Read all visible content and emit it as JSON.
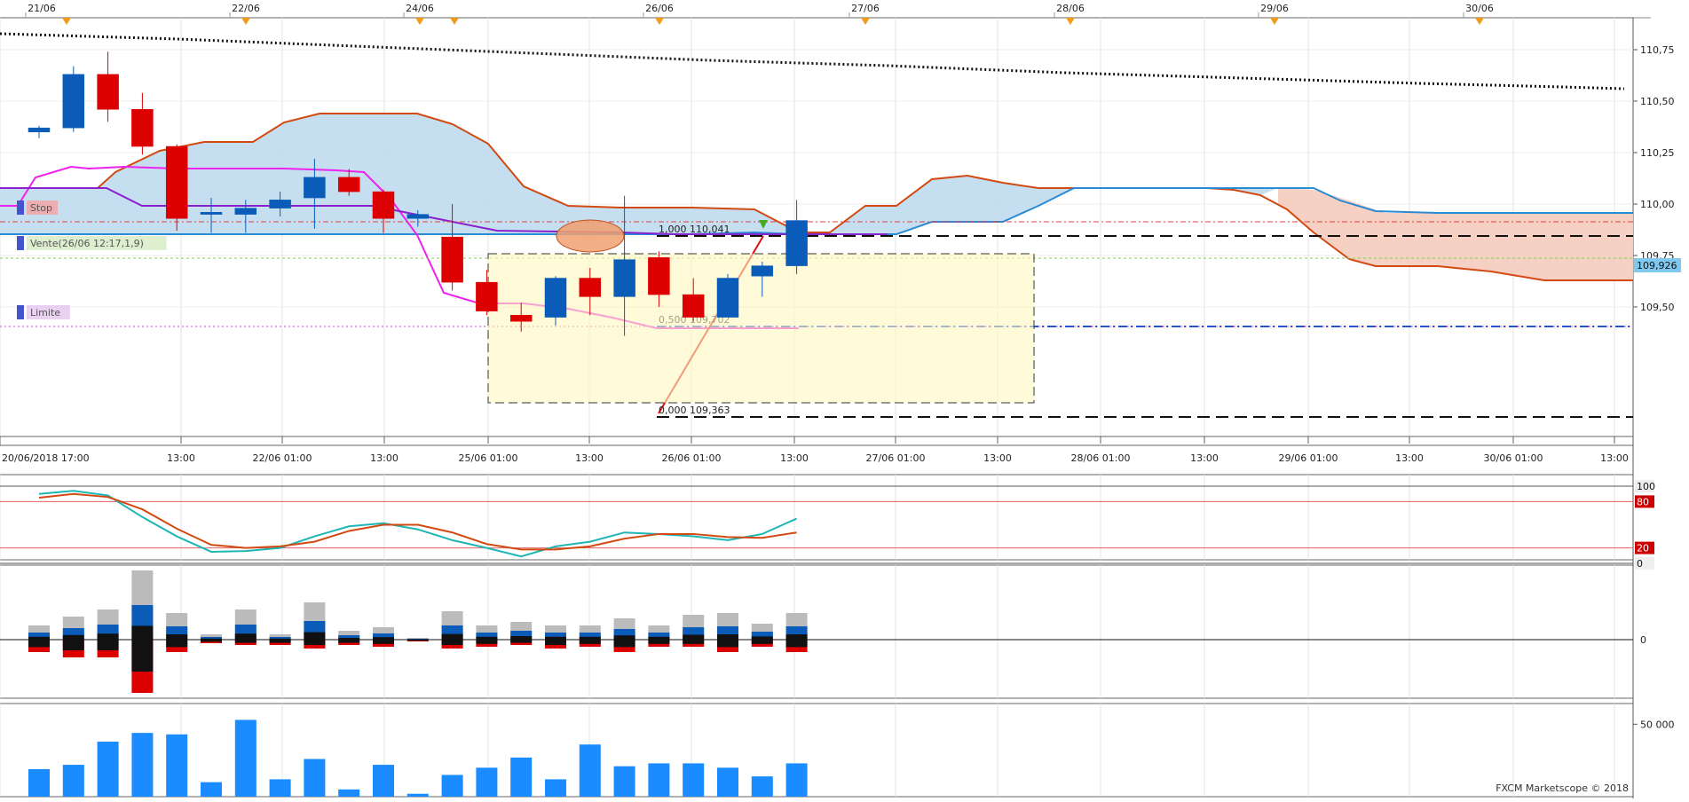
{
  "top_dates": [
    "21/06",
    "22/06",
    "24/06",
    "26/06",
    "27/06",
    "28/06",
    "29/06",
    "30/06"
  ],
  "time_labels": [
    "20/06/2018 17:00",
    "13:00",
    "22/06 01:00",
    "13:00",
    "25/06 01:00",
    "13:00",
    "26/06 01:00",
    "13:00",
    "27/06 01:00",
    "13:00",
    "28/06 01:00",
    "13:00",
    "29/06 01:00",
    "13:00",
    "30/06 01:00",
    "13:00"
  ],
  "price_labels": [
    "110,75",
    "110,50",
    "110,25",
    "110,00",
    "109,75",
    "109,50"
  ],
  "current_price": "109,926",
  "orders": {
    "stop": "Stop",
    "sell": "Vente(26/06 12:17,1,9)",
    "limit": "Limite"
  },
  "fib": {
    "top": "1,000 110,041",
    "mid": "0,500 109,702",
    "bottom": "0,000 109,363"
  },
  "stoch_labels": [
    "100",
    "80",
    "20",
    "0"
  ],
  "histo_zero": "0",
  "volume_label": "50 000",
  "copyright": "FXCM Marketscope © 2018",
  "colors": {
    "bull": "#0a5cb8",
    "bear": "#dd0000",
    "cloud_bull": "#bfdcee",
    "cloud_bear": "#f6cfc0",
    "tenkan": "#ee22ee",
    "kijun": "#8822cc",
    "stoch_k": "#1fb5b5",
    "stoch_d": "#d24a12",
    "volume": "#1a8cff"
  },
  "chart_data": {
    "type": "candlestick",
    "symbol_scale": "price",
    "ylim": [
      109.3,
      110.82
    ],
    "candles": [
      {
        "time": "20/06 17:00",
        "open": 110.35,
        "high": 110.38,
        "low": 110.32,
        "close": 110.37
      },
      {
        "time": "20/06 21:00",
        "open": 110.37,
        "high": 110.67,
        "low": 110.35,
        "close": 110.63
      },
      {
        "time": "21/06 01:00",
        "open": 110.63,
        "high": 110.74,
        "low": 110.4,
        "close": 110.46
      },
      {
        "time": "21/06 05:00",
        "open": 110.46,
        "high": 110.54,
        "low": 110.24,
        "close": 110.28
      },
      {
        "time": "21/06 09:00",
        "open": 110.28,
        "high": 110.29,
        "low": 109.87,
        "close": 109.93
      },
      {
        "time": "21/06 13:00",
        "open": 109.95,
        "high": 110.03,
        "low": 109.86,
        "close": 109.96
      },
      {
        "time": "21/06 17:00",
        "open": 109.95,
        "high": 110.02,
        "low": 109.86,
        "close": 109.98
      },
      {
        "time": "21/06 21:00",
        "open": 109.98,
        "high": 110.06,
        "low": 109.94,
        "close": 110.02
      },
      {
        "time": "22/06 01:00",
        "open": 110.03,
        "high": 110.22,
        "low": 109.88,
        "close": 110.13
      },
      {
        "time": "22/06 05:00",
        "open": 110.13,
        "high": 110.17,
        "low": 110.04,
        "close": 110.06
      },
      {
        "time": "22/06 09:00",
        "open": 110.06,
        "high": 110.07,
        "low": 109.86,
        "close": 109.93
      },
      {
        "time": "22/06 13:00",
        "open": 109.93,
        "high": 109.97,
        "low": 109.89,
        "close": 109.95
      },
      {
        "time": "22/06 17:00",
        "open": 109.84,
        "high": 110.0,
        "low": 109.58,
        "close": 109.62
      },
      {
        "time": "22/06 21:00",
        "open": 109.62,
        "high": 109.68,
        "low": 109.46,
        "close": 109.48
      },
      {
        "time": "25/06 01:00",
        "open": 109.46,
        "high": 109.52,
        "low": 109.38,
        "close": 109.43
      },
      {
        "time": "25/06 05:00",
        "open": 109.45,
        "high": 109.65,
        "low": 109.41,
        "close": 109.64
      },
      {
        "time": "25/06 09:00",
        "open": 109.64,
        "high": 109.69,
        "low": 109.46,
        "close": 109.55
      },
      {
        "time": "25/06 13:00",
        "open": 109.55,
        "high": 110.04,
        "low": 109.36,
        "close": 109.73
      },
      {
        "time": "25/06 17:00",
        "open": 109.74,
        "high": 109.77,
        "low": 109.5,
        "close": 109.56
      },
      {
        "time": "25/06 21:00",
        "open": 109.56,
        "high": 109.64,
        "low": 109.43,
        "close": 109.45
      },
      {
        "time": "26/06 01:00",
        "open": 109.45,
        "high": 109.66,
        "low": 109.45,
        "close": 109.64
      },
      {
        "time": "26/06 05:00",
        "open": 109.65,
        "high": 109.72,
        "low": 109.55,
        "close": 109.7
      },
      {
        "time": "26/06 09:00",
        "open": 109.7,
        "high": 110.02,
        "low": 109.66,
        "close": 109.92
      }
    ],
    "volume": [
      19000,
      22000,
      38000,
      44000,
      43000,
      10000,
      53000,
      12000,
      26000,
      5000,
      22000,
      2000,
      15000,
      20000,
      27000,
      12000,
      36000,
      21000,
      23000,
      23000,
      20000,
      14000,
      23000
    ]
  }
}
